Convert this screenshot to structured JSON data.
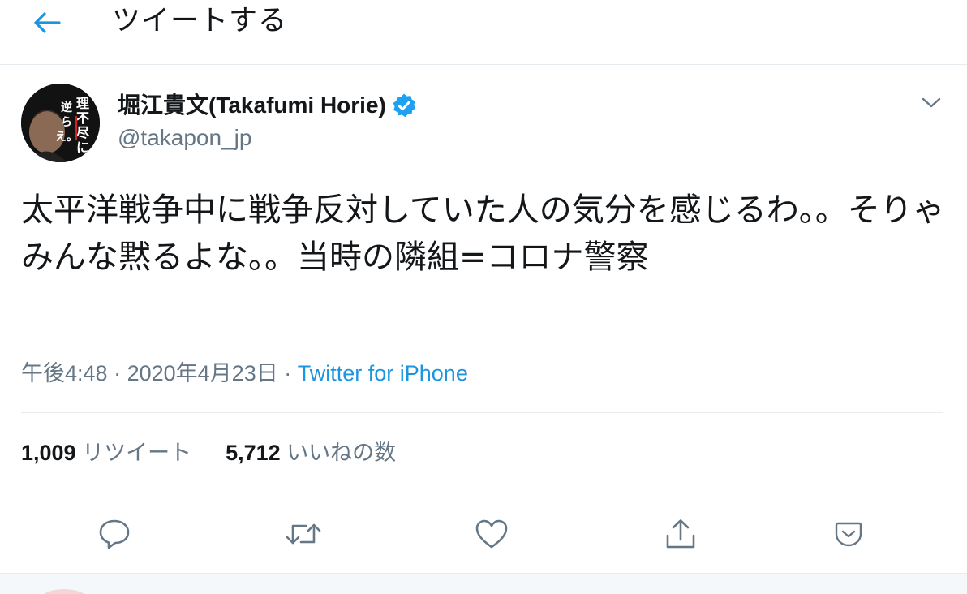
{
  "header": {
    "title": "ツイートする",
    "back_icon": "back-arrow-icon"
  },
  "author": {
    "name": "堀江貴文(Takafumi Horie)",
    "handle": "@takapon_jp",
    "verified": true,
    "avatar_text": "理不尽に逆らえ。"
  },
  "tweet": {
    "text": "太平洋戦争中に戦争反対していた人の気分を感じるわ。。そりゃみんな黙るよな。。当時の隣組=コロナ警察",
    "time": "午後4:48",
    "separator": "·",
    "date": "2020年4月23日",
    "source": "Twitter for iPhone"
  },
  "stats": {
    "retweets_count": "1,009",
    "retweets_label": "リツイート",
    "likes_count": "5,712",
    "likes_label": "いいねの数"
  },
  "actions": [
    {
      "name": "reply",
      "icon": "reply-icon"
    },
    {
      "name": "retweet",
      "icon": "retweet-icon"
    },
    {
      "name": "like",
      "icon": "heart-icon"
    },
    {
      "name": "share",
      "icon": "share-icon"
    },
    {
      "name": "save",
      "icon": "save-icon"
    }
  ],
  "colors": {
    "accent": "#1b95e0",
    "text": "#14171a",
    "secondary": "#657786",
    "border": "#e6ecf0"
  }
}
